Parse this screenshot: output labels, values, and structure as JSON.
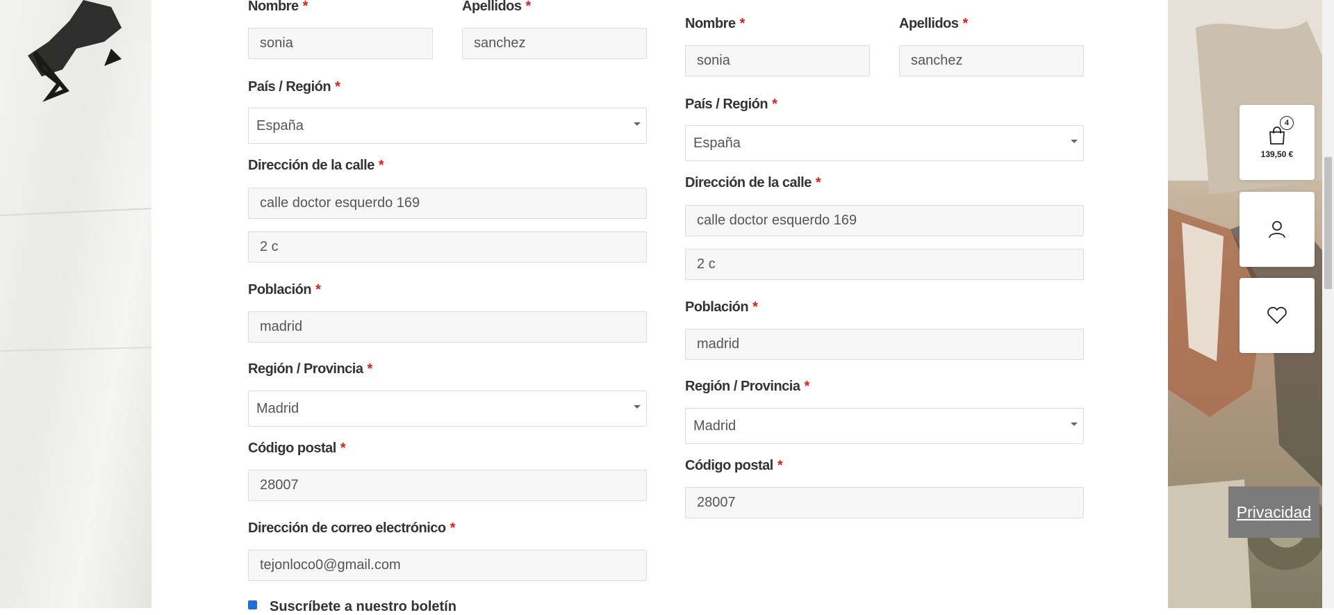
{
  "form_billing": {
    "first_name": {
      "label": "Nombre",
      "required": "*",
      "value": "sonia"
    },
    "last_name": {
      "label": "Apellidos",
      "required": "*",
      "value": "sanchez"
    },
    "country": {
      "label": "País / Región",
      "required": "*",
      "value": "España"
    },
    "street": {
      "label": "Dirección de la calle",
      "required": "*",
      "value": "calle doctor esquerdo 169",
      "value2": "2 c"
    },
    "city": {
      "label": "Población",
      "required": "*",
      "value": "madrid"
    },
    "region": {
      "label": "Región / Provincia",
      "required": "*",
      "value": "Madrid"
    },
    "postcode": {
      "label": "Código postal",
      "required": "*",
      "value": "28007"
    },
    "email": {
      "label": "Dirección de correo electrónico",
      "required": "*",
      "value": "tejonloco0@gmail.com"
    },
    "newsletter": {
      "label": "Suscríbete a nuestro boletín",
      "checked": true
    }
  },
  "form_shipping": {
    "first_name": {
      "label": "Nombre",
      "required": "*",
      "value": "sonia"
    },
    "last_name": {
      "label": "Apellidos",
      "required": "*",
      "value": "sanchez"
    },
    "country": {
      "label": "País / Región",
      "required": "*",
      "value": "España"
    },
    "street": {
      "label": "Dirección de la calle",
      "required": "*",
      "value": "calle doctor esquerdo 169",
      "value2": "2 c"
    },
    "city": {
      "label": "Población",
      "required": "*",
      "value": "madrid"
    },
    "region": {
      "label": "Región / Provincia",
      "required": "*",
      "value": "Madrid"
    },
    "postcode": {
      "label": "Código postal",
      "required": "*",
      "value": "28007"
    }
  },
  "sidebar": {
    "cart": {
      "count": "4",
      "amount": "139,50 €",
      "icon": "shopping-bag-icon"
    },
    "account": {
      "icon": "user-icon"
    },
    "wishlist": {
      "icon": "heart-icon"
    }
  },
  "privacy": {
    "label": "Privacidad"
  },
  "colors": {
    "required": "#e21b1b",
    "field_bg": "#f7f7f7",
    "privacy_bg": "#7b7b7b",
    "checkbox": "#1e6fd9"
  }
}
